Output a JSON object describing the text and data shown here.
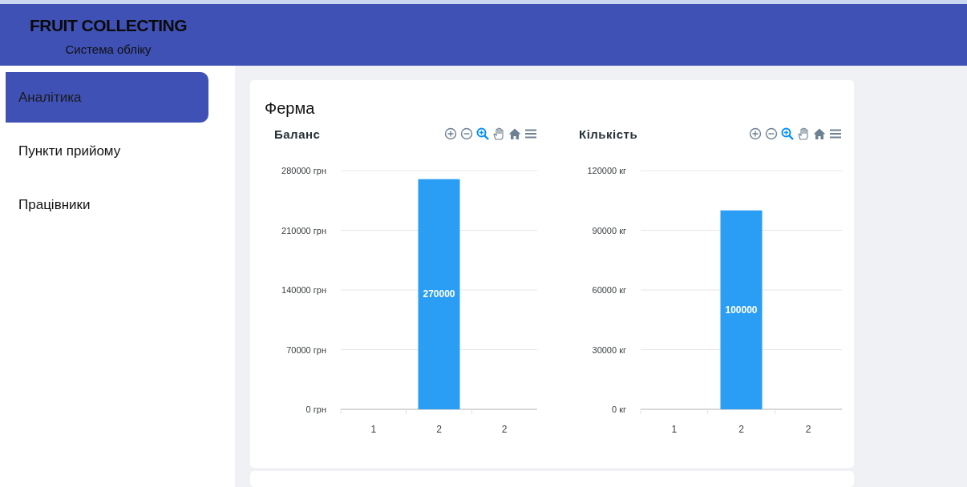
{
  "header": {
    "title": "FRUIT COLLECTING",
    "subtitle": "Система обліку"
  },
  "sidebar": {
    "items": [
      {
        "label": "Аналітика",
        "selected": true
      },
      {
        "label": "Пункти прийому",
        "selected": false
      },
      {
        "label": "Працівники",
        "selected": false
      }
    ]
  },
  "card": {
    "title": "Ферма",
    "charts": [
      {
        "toolbar": [
          {
            "kind": "zoom-in",
            "selected": false
          },
          {
            "kind": "zoom-out",
            "selected": false
          },
          {
            "kind": "zoom",
            "selected": true
          },
          {
            "kind": "pan",
            "selected": false
          },
          {
            "kind": "reset",
            "selected": false
          },
          {
            "kind": "menu",
            "selected": false
          }
        ],
        "chart_data": {
          "type": "bar",
          "title": "Баланс",
          "categories": [
            "1",
            "2",
            "2"
          ],
          "series": [
            {
              "color": "#2a9df4",
              "values": [
                null,
                270000,
                null
              ]
            }
          ],
          "ylim": [
            0,
            280000
          ],
          "yticks": [
            {
              "value": 0,
              "label": "0 грн"
            },
            {
              "value": 70000,
              "label": "70000 грн"
            },
            {
              "value": 140000,
              "label": "140000 грн"
            },
            {
              "value": 210000,
              "label": "210000 грн"
            },
            {
              "value": 280000,
              "label": "280000 грн"
            }
          ],
          "grid": true,
          "data_labels": true
        }
      },
      {
        "toolbar": [
          {
            "kind": "zoom-in",
            "selected": false
          },
          {
            "kind": "zoom-out",
            "selected": false
          },
          {
            "kind": "zoom",
            "selected": true
          },
          {
            "kind": "pan",
            "selected": false
          },
          {
            "kind": "reset",
            "selected": false
          },
          {
            "kind": "menu",
            "selected": false
          }
        ],
        "chart_data": {
          "type": "bar",
          "title": "Кількість",
          "categories": [
            "1",
            "2",
            "2"
          ],
          "series": [
            {
              "color": "#2a9df4",
              "values": [
                null,
                100000,
                null
              ]
            }
          ],
          "ylim": [
            0,
            120000
          ],
          "yticks": [
            {
              "value": 0,
              "label": "0 кг"
            },
            {
              "value": 30000,
              "label": "30000 кг"
            },
            {
              "value": 60000,
              "label": "60000 кг"
            },
            {
              "value": 90000,
              "label": "90000 кг"
            },
            {
              "value": 120000,
              "label": "120000 кг"
            }
          ],
          "grid": true,
          "data_labels": true
        }
      }
    ]
  }
}
